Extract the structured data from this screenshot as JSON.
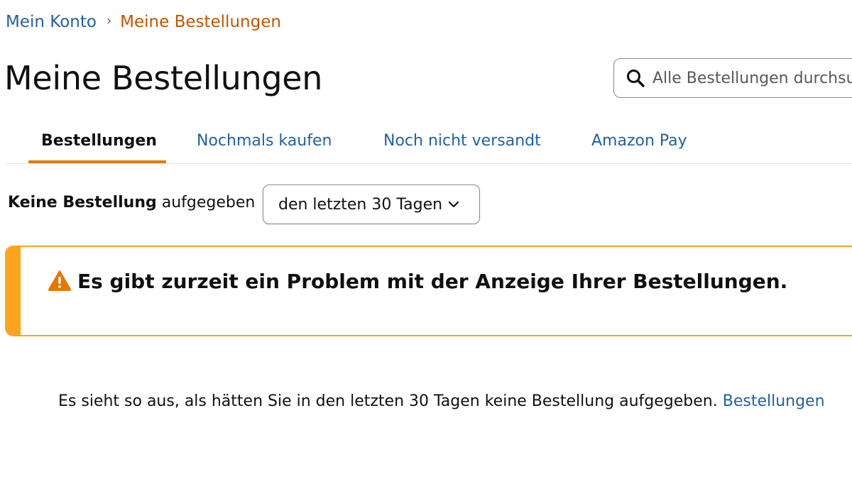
{
  "breadcrumb": {
    "account": "Mein Konto",
    "separator": "›",
    "current": "Meine Bestellungen"
  },
  "page": {
    "title": "Meine Bestellungen"
  },
  "search": {
    "placeholder": "Alle Bestellungen durchsuchen",
    "value": "",
    "icon": "search-icon"
  },
  "tabs": [
    {
      "label": "Bestellungen",
      "active": true
    },
    {
      "label": "Nochmals kaufen",
      "active": false
    },
    {
      "label": "Noch nicht versandt",
      "active": false
    },
    {
      "label": "Amazon Pay",
      "active": false
    }
  ],
  "filter": {
    "label_bold": "Keine Bestellung",
    "label_rest": "aufgegeben",
    "period_selected": "den letzten 30 Tagen"
  },
  "alert": {
    "message": "Es gibt zurzeit ein Problem mit der Anzeige Ihrer Bestellungen.",
    "icon": "warning-icon"
  },
  "empty_state": {
    "message": "Es sieht so aus, als hätten Sie in den letzten 30 Tagen keine Bestellung aufgegeben.",
    "link": "Bestellungen"
  },
  "colors": {
    "link": "#2162a1",
    "breadcrumb_current": "#c45500",
    "tab_underline": "#e77600",
    "alert_border": "#ffa41c"
  }
}
